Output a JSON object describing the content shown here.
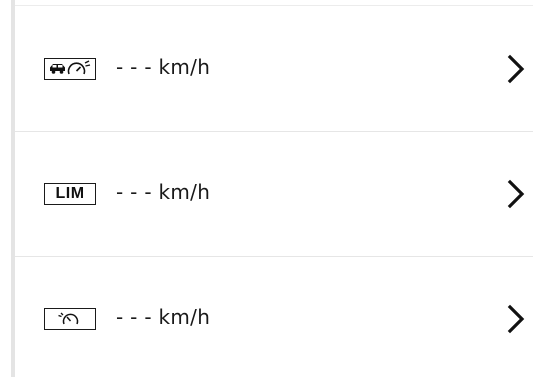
{
  "rows": [
    {
      "id": "adaptive-cruise",
      "icon": "car-speedometer-icon",
      "speed_text": "- - - km/h",
      "chevron": "chevron-right-icon"
    },
    {
      "id": "speed-limiter",
      "icon": "lim-badge",
      "icon_label": "LIM",
      "speed_text": "- - - km/h",
      "chevron": "chevron-right-icon"
    },
    {
      "id": "cruise-control",
      "icon": "speedometer-icon",
      "speed_text": "- - - km/h",
      "chevron": "chevron-right-icon"
    }
  ],
  "colors": {
    "text": "#1a1a1a",
    "divider": "#e6e6e6",
    "rail": "#e4e4e4",
    "background": "#ffffff"
  }
}
